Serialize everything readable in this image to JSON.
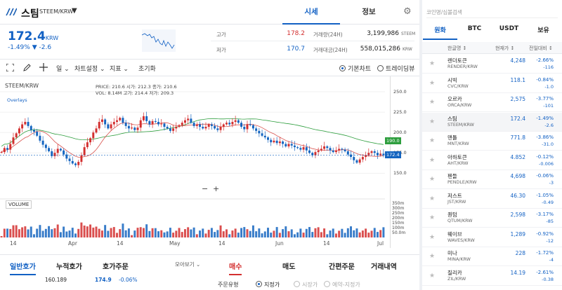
{
  "header": {
    "coin_name": "스팀",
    "pair": "STEEM/KRW",
    "tab_quote": "시세",
    "tab_info": "정보"
  },
  "ticker": {
    "price": "172.4",
    "currency": "KRW",
    "change": "-1.49% ▼ -2.6",
    "high_label": "고가",
    "high_value": "178.2",
    "low_label": "저가",
    "low_value": "170.7",
    "volume_label": "거래량(24H)",
    "volume_value": "3,199,986",
    "volume_unit": "STEEM",
    "amount_label": "거래대금(24H)",
    "amount_value": "558,015,286",
    "amount_unit": "KRW"
  },
  "toolbar": {
    "interval": "일",
    "chart_settings": "차트설정",
    "indicators": "지표",
    "reset": "초기화",
    "basic_chart": "기본차트",
    "tradingview": "트레이딩뷰"
  },
  "chart_overlay": {
    "symbol": "STEEM/KRW",
    "overlays": "Overlays",
    "ohlc_line1": "PRICE: 210.6   시가: 212.3   종가: 210.6",
    "ohlc_line2": "VOL: 8.14M   고가: 214.4   저가: 209.3",
    "volume_label": "VOLUME",
    "ma_tag": "190.0",
    "price_tag": "172.4"
  },
  "chart_data": {
    "type": "candlestick",
    "x_ticks": [
      "14",
      "Apr",
      "14",
      "May",
      "14",
      "Jun",
      "14",
      "Jul"
    ],
    "y_ticks": [
      250.0,
      225.0,
      200.0,
      175.0,
      150.0
    ],
    "y_range": [
      140,
      262
    ],
    "volume_ticks": [
      "350m",
      "300m",
      "250m",
      "200m",
      "150m",
      "100m",
      "50.0m"
    ],
    "last_price": 172.4,
    "ma_last": 190.0,
    "closes": [
      176,
      181,
      179,
      186,
      194,
      199,
      205,
      210,
      213,
      208,
      203,
      201,
      196,
      190,
      185,
      181,
      177,
      171,
      175,
      180,
      178,
      173,
      168,
      165,
      162,
      160,
      164,
      172,
      182,
      188,
      193,
      200,
      205,
      213,
      216,
      210,
      205,
      210,
      213,
      215,
      218,
      212,
      208,
      205,
      206,
      203,
      206,
      215,
      220,
      214,
      210,
      214,
      213,
      210,
      211,
      207,
      205,
      202,
      205,
      207,
      209,
      212,
      215,
      217,
      212,
      208,
      210,
      207,
      205,
      207,
      210,
      208,
      205,
      203,
      207,
      210,
      212,
      210,
      213,
      215,
      212,
      207,
      204,
      210,
      209,
      205,
      202,
      199,
      196,
      194,
      191,
      188,
      190,
      187,
      189,
      186,
      183,
      186,
      184,
      182,
      181,
      179,
      182,
      178,
      175,
      172,
      176,
      178,
      180,
      183,
      181,
      178,
      176,
      178,
      180,
      179,
      177,
      173,
      170,
      166,
      163,
      167,
      170,
      172,
      175,
      177,
      175,
      172,
      174,
      172
    ]
  },
  "bottom": {
    "tab1": "일반호가",
    "tab2": "누적호가",
    "tab3": "호가주문",
    "view": "모아보기",
    "ask_qty": "160.189",
    "ask_price": "174.9",
    "ask_chg": "-0.06%",
    "buy": "매수",
    "sell": "매도",
    "simple": "간편주문",
    "history": "거래내역",
    "order_type": "주문유형",
    "limit": "지정가",
    "market": "시장가",
    "reserve": "예약-지정가"
  },
  "sidebar": {
    "search_placeholder": "코인명/심볼검색",
    "tabs": [
      "원화",
      "BTC",
      "USDT",
      "보유"
    ],
    "col_name": "한글명 ↕",
    "col_price": "현재가 ↕",
    "col_change": "전일대비 ↕",
    "items": [
      {
        "name": "렌더토큰",
        "pair": "RENDER/KRW",
        "price": "4,248",
        "rate": "-2.66%",
        "diff": "-116"
      },
      {
        "name": "시빅",
        "pair": "CVC/KRW",
        "price": "118.1",
        "rate": "-0.84%",
        "diff": "-1.0"
      },
      {
        "name": "오르카",
        "pair": "ORCA/KRW",
        "price": "2,575",
        "rate": "-3.77%",
        "diff": "-101"
      },
      {
        "name": "스팀",
        "pair": "STEEM/KRW",
        "price": "172.4",
        "rate": "-1.49%",
        "diff": "-2.6"
      },
      {
        "name": "맨틀",
        "pair": "MNT/KRW",
        "price": "771.8",
        "rate": "-3.86%",
        "diff": "-31.0"
      },
      {
        "name": "아하토큰",
        "pair": "AHT/KRW",
        "price": "4.852",
        "rate": "-0.12%",
        "diff": "-0.006"
      },
      {
        "name": "펜들",
        "pair": "PENDLE/KRW",
        "price": "4,698",
        "rate": "-0.06%",
        "diff": "-3"
      },
      {
        "name": "저스트",
        "pair": "JST/KRW",
        "price": "46.30",
        "rate": "-1.05%",
        "diff": "-0.49"
      },
      {
        "name": "퀀텀",
        "pair": "QTUM/KRW",
        "price": "2,598",
        "rate": "-3.17%",
        "diff": "-85"
      },
      {
        "name": "웨이브",
        "pair": "WAVES/KRW",
        "price": "1,289",
        "rate": "-0.92%",
        "diff": "-12"
      },
      {
        "name": "미나",
        "pair": "MINA/KRW",
        "price": "228",
        "rate": "-1.72%",
        "diff": "-4"
      },
      {
        "name": "질리카",
        "pair": "ZIL/KRW",
        "price": "14.19",
        "rate": "-2.61%",
        "diff": "-0.38"
      }
    ]
  }
}
